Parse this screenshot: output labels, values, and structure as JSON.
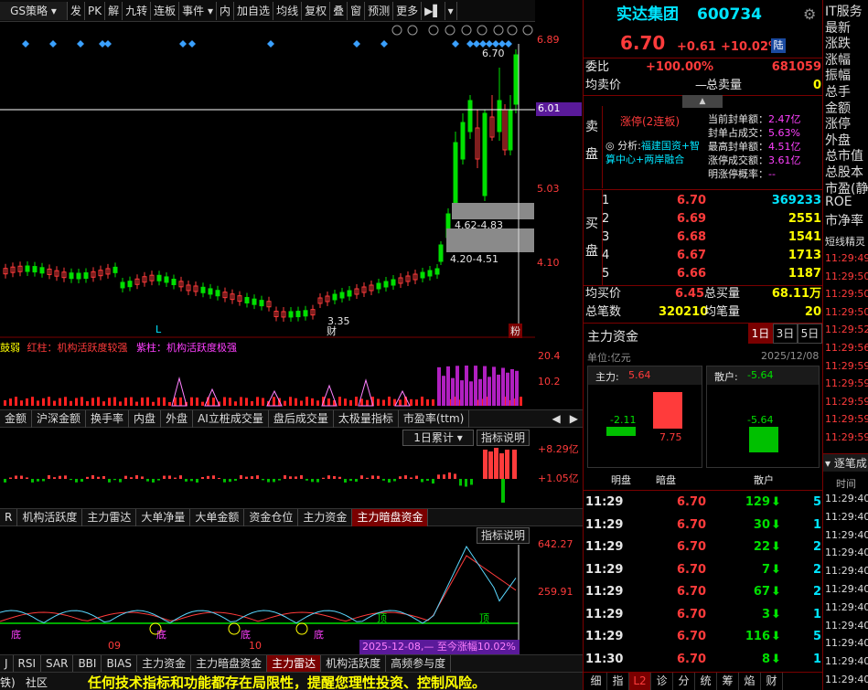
{
  "toolbar": {
    "strategy_combo": "GS策略",
    "items": [
      "发",
      "PK",
      "解",
      "九转",
      "连板",
      "事件",
      "内",
      "加自选",
      "均线",
      "复权",
      "叠",
      "窗",
      "预测",
      "更多"
    ]
  },
  "main_chart": {
    "price_labels": [
      "6.89",
      "6.01",
      "5.03",
      "4.10"
    ],
    "current_price_tag": "6.01",
    "high_label": "6.70",
    "box_labels": [
      "4.62-4.83",
      "4.20-4.51"
    ],
    "low_label": "3.35",
    "markers": [
      "L",
      "财"
    ],
    "subtitle_marker": "粉"
  },
  "indicator1": {
    "legend": [
      "鼓弱",
      "红柱：机构活跃度较强",
      "紫柱：机构活跃度极强"
    ],
    "axis": [
      "20.4",
      "10.2"
    ]
  },
  "tabs1": [
    "金额",
    "沪深金额",
    "换手率",
    "内盘",
    "外盘",
    "AI立桩成交量",
    "盘后成交量",
    "太极量指标",
    "市盈率(ttm)"
  ],
  "indicator2": {
    "combo": "1日累计",
    "explain_button": "指标说明",
    "axis": [
      "+8.29亿",
      "+1.05亿"
    ]
  },
  "tabs2": [
    "R",
    "机构活跃度",
    "主力雷达",
    "大单净量",
    "大单金额",
    "资金仓位",
    "主力资金",
    "主力暗盘资金"
  ],
  "indicator3": {
    "explain_button": "指标说明",
    "axis": [
      "642.27",
      "259.91"
    ],
    "date_labels": [
      "09",
      "10"
    ],
    "status_text": "2025-12-08,— 至今涨幅10.02%",
    "signals": [
      "底",
      "底",
      "底",
      "底",
      "顶",
      "顶"
    ]
  },
  "tabs3": [
    "J",
    "RSI",
    "SAR",
    "BBI",
    "BIAS",
    "主力资金",
    "主力暗盘资金",
    "主力雷达",
    "机构活跃度",
    "高频参与度"
  ],
  "bottom": {
    "left_items": [
      "铁)",
      "社区"
    ],
    "warning": "任何技术指标和功能都存在局限性，提醒您理性投资、控制风险。"
  },
  "quote": {
    "name": "实达集团",
    "code": "600734",
    "price": "6.70",
    "change": "+0.61",
    "change_pct": "+10.02%",
    "board_badge": "陆",
    "weibi_label": "委比",
    "weibi_value": "+100.00%",
    "weibi_vol": "681059",
    "avg_sell_label": "均卖价",
    "avg_sell_value": "—",
    "total_sell_label": "总卖量",
    "total_sell_value": "0",
    "sell_side_label": "卖盘",
    "limit_title": "涨停(2连板)",
    "analysis_label": "分析:",
    "analysis_text": "福建国资+智算中心+两岸融合",
    "limit_stats": [
      {
        "label": "当前封单额：",
        "value": "2.47亿"
      },
      {
        "label": "封单占成交：",
        "value": "5.63%"
      },
      {
        "label": "最高封单额：",
        "value": "4.51亿"
      },
      {
        "label": "涨停成交额：",
        "value": "3.61亿"
      },
      {
        "label": "明涨停概率：",
        "value": "--"
      }
    ],
    "buy_side_label": "买盘",
    "bids": [
      {
        "level": "1",
        "price": "6.70",
        "vol": "369233"
      },
      {
        "level": "2",
        "price": "6.69",
        "vol": "2551"
      },
      {
        "level": "3",
        "price": "6.68",
        "vol": "1541"
      },
      {
        "level": "4",
        "price": "6.67",
        "vol": "1713"
      },
      {
        "level": "5",
        "price": "6.66",
        "vol": "1187"
      }
    ],
    "avg_buy_label": "均买价",
    "avg_buy_value": "6.45",
    "total_buy_label": "总买量",
    "total_buy_value": "68.11万",
    "total_trades_label": "总笔数",
    "total_trades_value": "320210",
    "avg_trade_label": "均笔量",
    "avg_trade_value": "20",
    "fund_title": "主力资金",
    "fund_tabs": [
      "1日",
      "3日",
      "5日"
    ],
    "fund_unit": "单位:亿元",
    "fund_date": "2025/12/08",
    "main_label": "主力:",
    "main_value": "5.64",
    "retail_label": "散户:",
    "retail_value": "-5.64",
    "bar_dark_value": "-2.11",
    "bar_hidden_value": "7.75",
    "bar_retail_value": "-5.64",
    "bar_captions": [
      "明盘",
      "暗盘",
      "散户"
    ],
    "ticks": [
      {
        "time": "11:29",
        "price": "6.70",
        "vol": "129",
        "n": "5"
      },
      {
        "time": "11:29",
        "price": "6.70",
        "vol": "30",
        "n": "1"
      },
      {
        "time": "11:29",
        "price": "6.70",
        "vol": "22",
        "n": "2"
      },
      {
        "time": "11:29",
        "price": "6.70",
        "vol": "7",
        "n": "2"
      },
      {
        "time": "11:29",
        "price": "6.70",
        "vol": "67",
        "n": "2"
      },
      {
        "time": "11:29",
        "price": "6.70",
        "vol": "3",
        "n": "1"
      },
      {
        "time": "11:29",
        "price": "6.70",
        "vol": "116",
        "n": "5"
      },
      {
        "time": "11:30",
        "price": "6.70",
        "vol": "8",
        "n": "1"
      }
    ],
    "bottom_tabs": [
      "细",
      "指",
      "L2",
      "诊",
      "分",
      "统",
      "筹",
      "焰",
      "财"
    ]
  },
  "side": {
    "labels": [
      "IT服务",
      "最新",
      "涨跌",
      "涨幅",
      "振幅",
      "总手",
      "金额",
      "涨停",
      "外盘",
      "总市值",
      "总股本",
      "市盈(静)",
      "ROE",
      "市净率"
    ],
    "section": "短线精灵",
    "times": [
      "11:29:49",
      "11:29:50",
      "11:29:50",
      "11:29:50",
      "11:29:52",
      "11:29:56",
      "11:29:59",
      "11:29:59",
      "11:29:59",
      "11:29:59",
      "11:29:59"
    ],
    "trade_header": "逐笔成",
    "trade_col": "时间",
    "trade_times": [
      "11:29:40",
      "11:29:40",
      "11:29:40",
      "11:29:40",
      "11:29:40",
      "11:29:40",
      "11:29:40",
      "11:29:40",
      "11:29:40",
      "11:29:40",
      "11:29:40"
    ]
  }
}
